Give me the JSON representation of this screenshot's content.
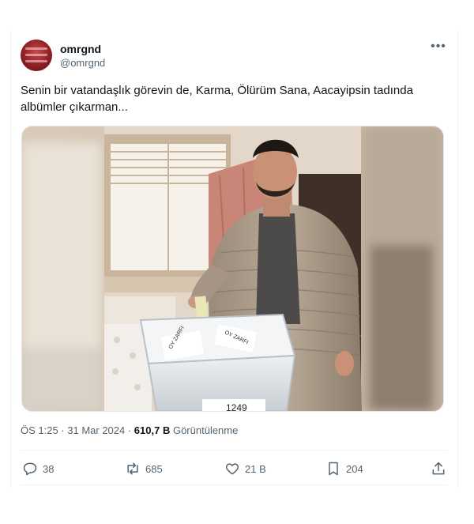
{
  "user": {
    "display_name": "omrgnd",
    "handle": "@omrgnd"
  },
  "tweet": {
    "text": "Senin bir vatandaşlık görevin de, Karma, Ölürüm Sana, Aacayipsin tadında albümler çıkarman...",
    "time": "ÖS 1:25 · 31 Mar 2024 · ",
    "views": "610,7 B",
    "views_label": "Görüntülenme"
  },
  "media": {
    "box_label_left": "OY ZARFI",
    "box_label_right": "OY ZARFI",
    "box_number": "1249"
  },
  "actions": {
    "replies": "38",
    "reposts": "685",
    "likes": "21 B",
    "bookmarks": "204"
  },
  "icons": [
    "more-icon",
    "reply-icon",
    "repost-icon",
    "like-icon",
    "bookmark-icon",
    "share-icon"
  ],
  "colors": {
    "text_primary": "#0f1419",
    "text_secondary": "#536471",
    "divider": "#eff3f4"
  }
}
